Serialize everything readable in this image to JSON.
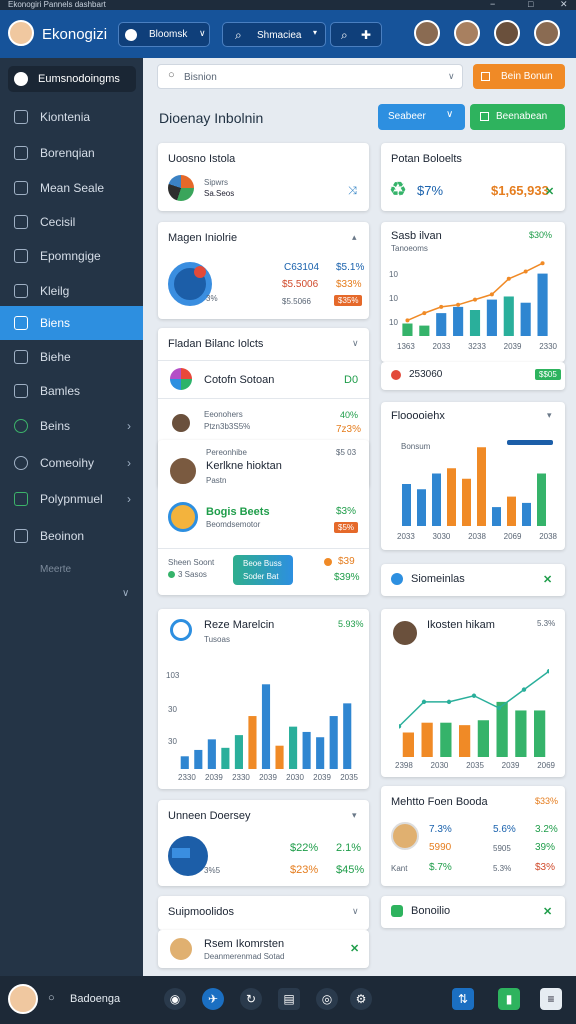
{
  "window": {
    "title": "Ekonogiri Pannels dashbart"
  },
  "top": {
    "app_name": "Ekonogizi",
    "search1": "Bloomsk",
    "search2": "Shmaciea"
  },
  "sidebar": {
    "items": [
      {
        "label": "Eumsnodoingms",
        "active": false,
        "highlight": true
      },
      {
        "label": "Kiontenia"
      },
      {
        "label": "Borenqian"
      },
      {
        "label": "Mean Seale"
      },
      {
        "label": "Cecisil"
      },
      {
        "label": "Epomngige"
      },
      {
        "label": "Kleilg"
      },
      {
        "label": "Biens",
        "active": true
      },
      {
        "label": "Biehe"
      },
      {
        "label": "Bamles"
      },
      {
        "label": "Beins",
        "arrow": true
      },
      {
        "label": "Comeoihy",
        "arrow": true
      },
      {
        "label": "Polypnmuel",
        "arrow": true
      },
      {
        "label": "Beoinon"
      }
    ],
    "footer_label": "Meerte"
  },
  "toolbar": {
    "search_placeholder": "Bisnion",
    "orange_btn": "Bein Bonun",
    "heading": "Dioenay Inbolnin",
    "blue_btn": "Seabeer",
    "green_btn": "Beenabean"
  },
  "cards": {
    "c1": {
      "title": "Uoosno Istola",
      "line1": "Sipwrs",
      "line2": "Sa.Seos"
    },
    "c2": {
      "title": "Potan Boloelts",
      "amount": "$7%",
      "value": "$1,65,933"
    },
    "c3": {
      "title": "Magen Iniolrie",
      "v1": "C63104",
      "p1": "$5.1%",
      "v2": "$5.5006",
      "p2": "$33%",
      "v3": "$5.5066",
      "p3": "$35%",
      "small": "3%"
    },
    "c4": {
      "title": "Sasb ilvan",
      "pct": "$30%",
      "sub": "Tanoeoms",
      "ticks": [
        "10",
        "10",
        "10"
      ],
      "xticks": [
        "1363",
        "2033",
        "3233",
        "2039",
        "2330"
      ],
      "footer": "253060",
      "badge": "$$05"
    },
    "c5": {
      "title": "Fladan Bilanc Iolcts",
      "row1": "Cotofn Sotoan",
      "row1v": "D0",
      "row2a": "Eeonohers",
      "row2b": "Ptzn3b3S5%",
      "row2c": "40%",
      "row2d": "7z3%"
    },
    "c6": {
      "title": "Flooooiehx",
      "sub": "Bonsum",
      "xticks": [
        "2033",
        "3030",
        "2038",
        "2069",
        "2038"
      ]
    },
    "c7": {
      "title": "Kerlkne hioktan",
      "top": "Pereonhibe",
      "right": "$5 03",
      "sub": "Pastn",
      "green": "Bogis Beets",
      "sub2": "Beomdsemotor",
      "p1": "$3%",
      "p2": "$5%",
      "l1": "Sheen Soont",
      "l2": "3 Sasos",
      "btn1": "Beoe Buss",
      "btn2": "Soder Bat",
      "r1": "$39",
      "r2": "$39%"
    },
    "c8": {
      "title": "Siomeinlas"
    },
    "c9": {
      "title": "Reze Marelcin",
      "sub": "Tusoas",
      "pct": "5.93%",
      "ticks": [
        "103",
        "30",
        "30"
      ],
      "xticks": [
        "2330",
        "2039",
        "2330",
        "2039",
        "2030",
        "2039",
        "2035"
      ]
    },
    "c10": {
      "title": "Ikosten hikam",
      "pct": "5.3%",
      "xticks": [
        "2398",
        "2030",
        "2035",
        "2039",
        "2069"
      ]
    },
    "c11": {
      "title": "Unneen Doersey",
      "l": "3%5",
      "a": "$22%",
      "b": "2.1%",
      "c": "$23%",
      "d": "$45%"
    },
    "c12": {
      "title": "Mehtto Foen Booda",
      "pct": "$33%",
      "a": "7.3%",
      "b": "5.6%",
      "c": "3.2%",
      "d": "5990",
      "e": "5905",
      "f": "39%",
      "k": "Kant",
      "g": "$.7%",
      "h": "5.3%",
      "i": "$3%"
    },
    "c13": {
      "title": "Suipmoolidos"
    },
    "c14": {
      "title": "Bonoilio"
    },
    "c15": {
      "title": "Rsem Ikomrsten",
      "sub": "Deanmerenmad Sotad"
    }
  },
  "bottom": {
    "label": "Badoenga"
  },
  "colors": {
    "blue": "#2f86d1",
    "green": "#35b36a",
    "orange": "#f08a26",
    "teal": "#2aaf9b"
  },
  "chart_data": [
    {
      "type": "bar",
      "title": "Sasb ilvan",
      "values": [
        12,
        10,
        22,
        28,
        25,
        35,
        38,
        32,
        60
      ],
      "line": [
        15,
        22,
        28,
        30,
        35,
        40,
        55,
        62,
        70
      ]
    },
    {
      "type": "bar",
      "title": "Flooooiehx",
      "values": [
        40,
        35,
        50,
        55,
        45,
        75,
        18,
        28,
        22,
        50
      ]
    },
    {
      "type": "bar",
      "title": "Reze Marelcin",
      "values": [
        12,
        18,
        28,
        20,
        32,
        50,
        80,
        22,
        40,
        35,
        30,
        50,
        62
      ]
    },
    {
      "type": "line",
      "title": "Ikosten hikam",
      "values": [
        25,
        45,
        45,
        50,
        40,
        55,
        70
      ]
    }
  ]
}
